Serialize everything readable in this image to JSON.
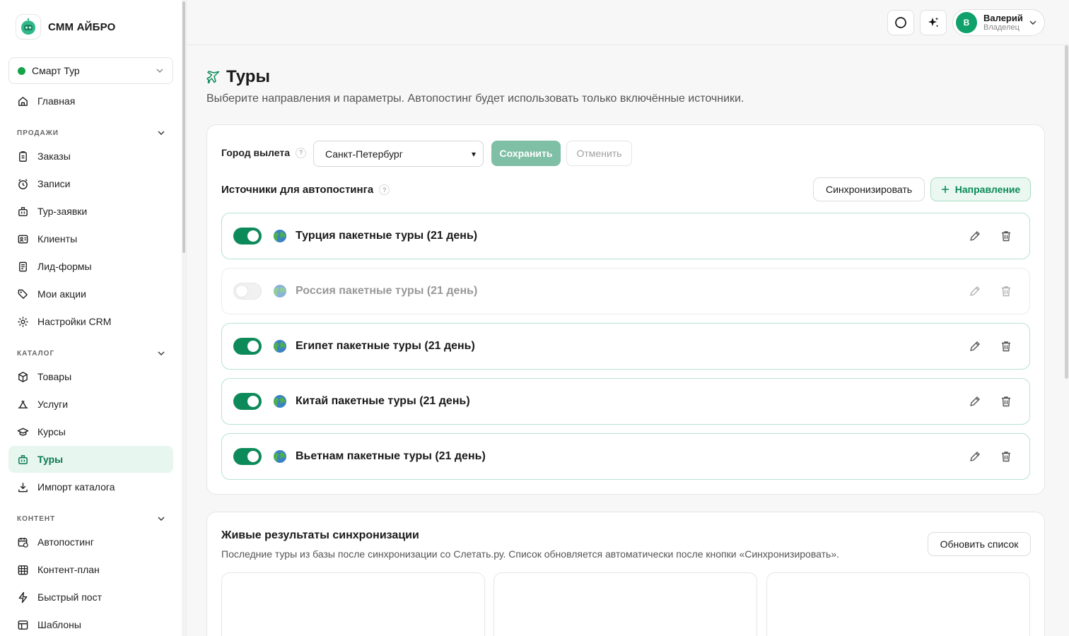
{
  "brand": {
    "name": "СММ АЙБРО"
  },
  "workspace": {
    "name": "Смарт Тур"
  },
  "nav": {
    "home": "Главная",
    "sales_header": "ПРОДАЖИ",
    "sales": [
      "Заказы",
      "Записи",
      "Тур-заявки",
      "Клиенты",
      "Лид-формы",
      "Мои акции",
      "Настройки CRM"
    ],
    "catalog_header": "КАТАЛОГ",
    "catalog": [
      "Товары",
      "Услуги",
      "Курсы",
      "Туры",
      "Импорт каталога"
    ],
    "content_header": "КОНТЕНТ",
    "content": [
      "Автопостинг",
      "Контент-план",
      "Быстрый пост",
      "Шаблоны"
    ]
  },
  "user": {
    "initial": "В",
    "name": "Валерий",
    "role": "Владелец"
  },
  "page": {
    "title": "Туры",
    "subtitle": "Выберите направления и параметры. Автопостинг будет использовать только включённые источники."
  },
  "settings": {
    "city_label": "Город вылета",
    "help_mark": "?",
    "city_value": "Санкт-Петербург",
    "save_label": "Сохранить",
    "cancel_label": "Отменить",
    "sources_title": "Источники для автопостинга",
    "sync_label": "Синхронизировать",
    "add_direction_label": "Направление"
  },
  "sources": [
    {
      "label": "Турция пакетные туры (21 день)",
      "enabled": true
    },
    {
      "label": "Россия пакетные туры (21 день)",
      "enabled": false
    },
    {
      "label": "Египет пакетные туры (21 день)",
      "enabled": true
    },
    {
      "label": "Китай пакетные туры (21 день)",
      "enabled": true
    },
    {
      "label": "Вьетнам пакетные туры (21 день)",
      "enabled": true
    }
  ],
  "live": {
    "title": "Живые результаты синхронизации",
    "subtitle": "Последние туры из базы после синхронизации со Слетать.ру. Список обновляется автоматически после кнопки «Синхронизировать».",
    "refresh_label": "Обновить список"
  },
  "colors": {
    "accent": "#0d8a5a",
    "accent_light": "#e7f6ef"
  }
}
